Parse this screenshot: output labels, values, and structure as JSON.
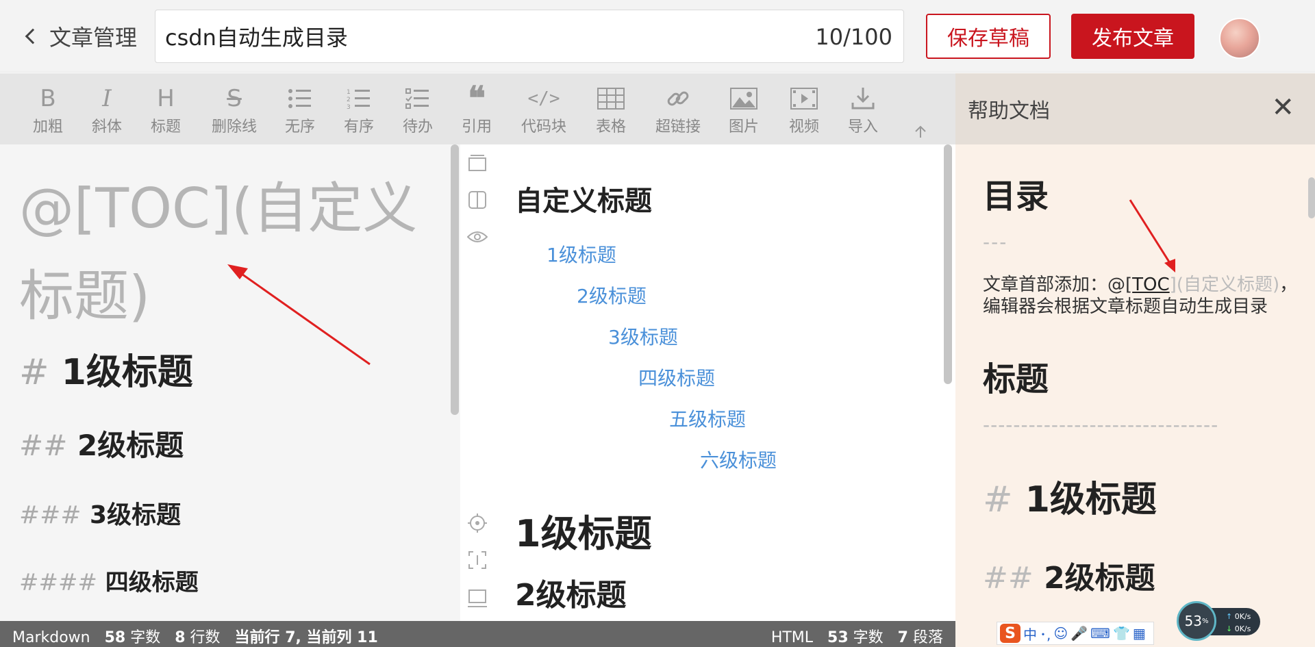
{
  "header": {
    "back_label": "文章管理",
    "title_value": "csdn自动生成目录",
    "title_count": "10/100",
    "save_draft_label": "保存草稿",
    "publish_label": "发布文章"
  },
  "toolbar": {
    "items": [
      {
        "label": "加粗",
        "icon": "bold-icon",
        "glyph": "B"
      },
      {
        "label": "斜体",
        "icon": "italic-icon",
        "glyph": "I"
      },
      {
        "label": "标题",
        "icon": "heading-icon",
        "glyph": "H"
      },
      {
        "label": "删除线",
        "icon": "strikethrough-icon",
        "glyph": "S"
      },
      {
        "label": "无序",
        "icon": "unordered-list-icon",
        "glyph": "☰"
      },
      {
        "label": "有序",
        "icon": "ordered-list-icon",
        "glyph": "☰"
      },
      {
        "label": "待办",
        "icon": "todo-list-icon",
        "glyph": "☰"
      },
      {
        "label": "引用",
        "icon": "quote-icon",
        "glyph": "❝"
      },
      {
        "label": "代码块",
        "icon": "code-block-icon",
        "glyph": "</>"
      },
      {
        "label": "表格",
        "icon": "table-icon",
        "glyph": "▦"
      },
      {
        "label": "超链接",
        "icon": "link-icon",
        "glyph": "🔗"
      },
      {
        "label": "图片",
        "icon": "image-icon",
        "glyph": "▣"
      },
      {
        "label": "视频",
        "icon": "video-icon",
        "glyph": "▶"
      },
      {
        "label": "导入",
        "icon": "import-icon",
        "glyph": "⤓"
      }
    ]
  },
  "help": {
    "title": "帮助文档",
    "toc_heading": "目录",
    "toc_dash": "---",
    "toc_text_prefix": "文章首部添加：@[",
    "toc_code": "TOC",
    "toc_text_gray": "](自定义标题)",
    "toc_text_suffix": "，",
    "toc_text_line2": "编辑器会根据文章标题自动生成目录",
    "title_heading": "标题",
    "title_dash": "-------------------------------",
    "md_h1_hash": "#",
    "md_h1_text": "1级标题",
    "md_h2_hash": "##",
    "md_h2_text": "2级标题"
  },
  "editor": {
    "toc_line": "@[TOC](自定义标题)",
    "headings": [
      {
        "hash": "#",
        "text": "1级标题"
      },
      {
        "hash": "##",
        "text": "2级标题"
      },
      {
        "hash": "###",
        "text": "3级标题"
      },
      {
        "hash": "####",
        "text": "四级标题"
      }
    ]
  },
  "preview": {
    "toc_title": "自定义标题",
    "toc_links": [
      "1级标题",
      "2级标题",
      "3级标题",
      "四级标题",
      "五级标题",
      "六级标题"
    ],
    "h1": "1级标题",
    "h2": "2级标题"
  },
  "status": {
    "mode": "Markdown",
    "left_words": "58",
    "left_words_label": "字数",
    "left_lines": "8",
    "left_lines_label": "行数",
    "cursor": "当前行 7, 当前列 11",
    "right_mode": "HTML",
    "right_words": "53",
    "right_words_label": "字数",
    "right_paras": "7",
    "right_paras_label": "段落"
  },
  "widgets": {
    "net_percent": "53",
    "net_up": "0K/s",
    "net_down": "0K/s",
    "ime_logo": "S",
    "ime_mode": "中"
  },
  "colors": {
    "accent": "#c9151e",
    "link": "#4a90d9",
    "status_bg": "#666666",
    "help_bg": "#fbf1e8"
  }
}
